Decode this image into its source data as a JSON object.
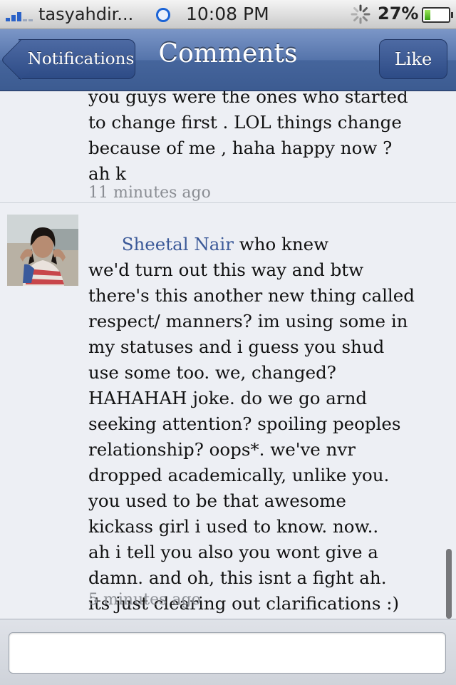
{
  "status_bar": {
    "carrier": "tasyahdir...",
    "time": "10:08 PM",
    "battery": "27%",
    "battery_level": 0.27
  },
  "nav": {
    "back_label": "Notifications",
    "title": "Comments",
    "like_label": "Like"
  },
  "comments": [
    {
      "text": "you guys were the ones who started\nto change first . LOL things change\nbecause of me , haha happy now ?\nah k",
      "time": "11 minutes ago"
    },
    {
      "author": "Sheetal Nair",
      "text": "who knew\nwe'd turn out this way and btw\nthere's this another new thing called\nrespect/ manners? im using some in\nmy statuses and i guess you shud\nuse some too. we, changed?\nHAHAHAH joke. do we go arnd\nseeking attention? spoiling peoples\nrelationship? oops*. we've nvr\ndropped academically, unlike you.\nyou used to be that awesome\nkickass girl i used to know. now..\nah i tell you also you wont give a\ndamn. and oh, this isnt a fight ah.\nits just clearing out clarifications :)",
      "time": "5 minutes ago"
    }
  ],
  "composer": {
    "value": ""
  },
  "colors": {
    "nav_blue": "#3c5b91",
    "author_link": "#3b5998",
    "background": "#edeff4"
  }
}
